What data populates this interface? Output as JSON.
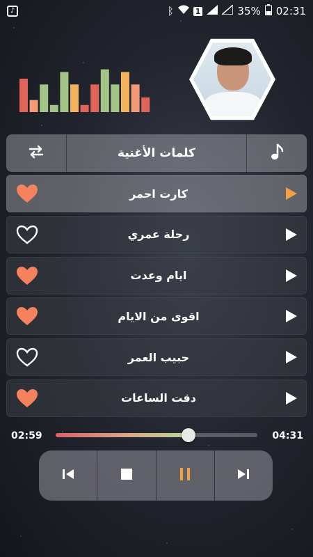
{
  "status_bar": {
    "battery": "35%",
    "time": "02:31",
    "sim_slot": "1",
    "icons": [
      "app-icon",
      "bluetooth-icon",
      "wifi-icon",
      "sim-icon",
      "signal-icon",
      "battery-icon"
    ]
  },
  "equalizer": {
    "bars": [
      {
        "level": 0.75,
        "color": "#e0645a"
      },
      {
        "level": 0.27,
        "color": "#f29a76"
      },
      {
        "level": 0.62,
        "color": "#a3c487"
      },
      {
        "level": 0.16,
        "color": "#a3c487"
      },
      {
        "level": 0.9,
        "color": "#a3c487"
      },
      {
        "level": 0.62,
        "color": "#f2b25e"
      },
      {
        "level": 0.16,
        "color": "#e0645a"
      },
      {
        "level": 0.62,
        "color": "#e0645a"
      },
      {
        "level": 0.96,
        "color": "#a3c487"
      },
      {
        "level": 0.62,
        "color": "#a3c487"
      },
      {
        "level": 0.9,
        "color": "#f2b25e"
      },
      {
        "level": 0.62,
        "color": "#f29a76"
      },
      {
        "level": 0.33,
        "color": "#e0645a"
      }
    ]
  },
  "toolbar": {
    "title": "كلمات الأغنية",
    "left_icon": "repeat-icon",
    "right_icon": "music-note-icon"
  },
  "songs": [
    {
      "title": "كارت احمر",
      "favorite": true,
      "active": true
    },
    {
      "title": "رحلة عمري",
      "favorite": false,
      "active": false
    },
    {
      "title": "ايام وعدت",
      "favorite": true,
      "active": false
    },
    {
      "title": "اقوى من الايام",
      "favorite": true,
      "active": false
    },
    {
      "title": "حبيب العمر",
      "favorite": false,
      "active": false
    },
    {
      "title": "دقت الساعات",
      "favorite": true,
      "active": false
    }
  ],
  "player": {
    "elapsed": "02:59",
    "duration": "04:31",
    "progress": 0.66
  },
  "controls": {
    "buttons": [
      "previous-icon",
      "stop-icon",
      "pause-icon",
      "next-icon"
    ]
  },
  "colors": {
    "heart": "#f5825f",
    "active_play": "#f2a042",
    "pause": "#f2a042",
    "white": "#ffffff"
  }
}
